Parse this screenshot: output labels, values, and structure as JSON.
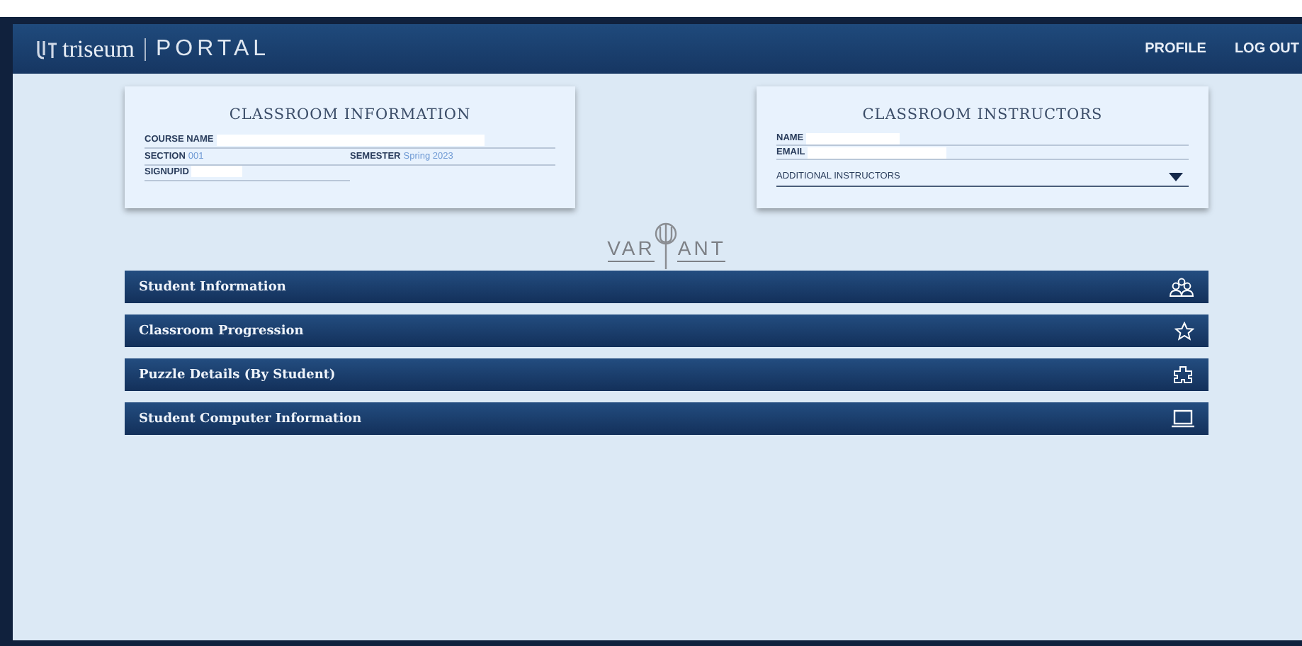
{
  "header": {
    "logo": "triseum",
    "title": "PORTAL",
    "nav": [
      {
        "label": "PROFILE"
      },
      {
        "label": "LOG OUT"
      }
    ]
  },
  "classroom_information": {
    "title": "CLASSROOM INFORMATION",
    "course_name_label": "COURSE NAME",
    "section_label": "SECTION",
    "section": "001",
    "semester_label": "SEMESTER",
    "semester": "Spring 2023",
    "signupid_label": "SIGNUPID"
  },
  "classroom_instructors": {
    "title": "CLASSROOM INSTRUCTORS",
    "name_label": "NAME",
    "email_label": "EMAIL",
    "additional": "ADDITIONAL INSTRUCTORS"
  },
  "game_logo": {
    "left": "VAR",
    "right": "ANT"
  },
  "sections": [
    {
      "label": "Student Information",
      "kind": "people"
    },
    {
      "label": "Classroom Progression",
      "kind": "star"
    },
    {
      "label": "Puzzle Details (By Student)",
      "kind": "puzzle"
    },
    {
      "label": "Student Computer Information",
      "kind": "laptop"
    }
  ]
}
